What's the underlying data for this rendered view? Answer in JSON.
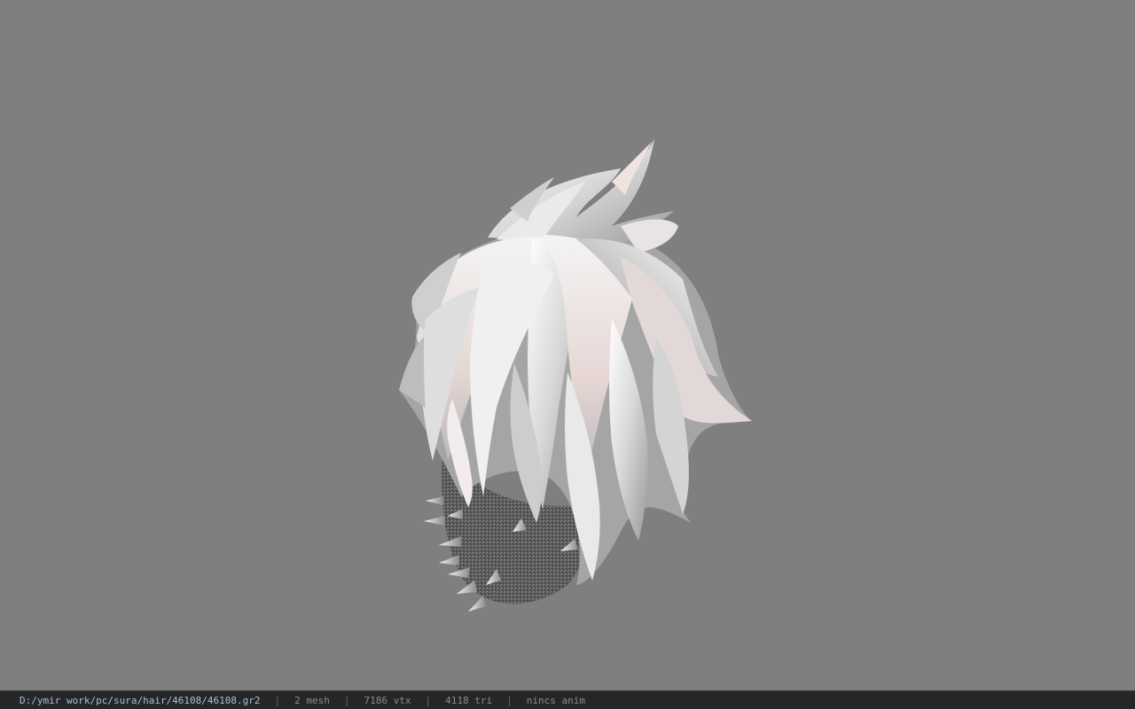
{
  "viewer": {
    "model_name": "46108.gr2"
  },
  "status_bar": {
    "path": "D:/ymir work/pc/sura/hair/46108/46108.gr2",
    "separator": "|",
    "mesh": "2 mesh",
    "vertices": "7186 vtx",
    "triangles": "4118 tri",
    "anim": "nincs anim"
  },
  "colors": {
    "background": "#7f7f7f",
    "status_bg": "#262626",
    "hair": "#e6e6e6",
    "hair_tint": "#e8d4d2",
    "mask": "#5a5a5a"
  }
}
